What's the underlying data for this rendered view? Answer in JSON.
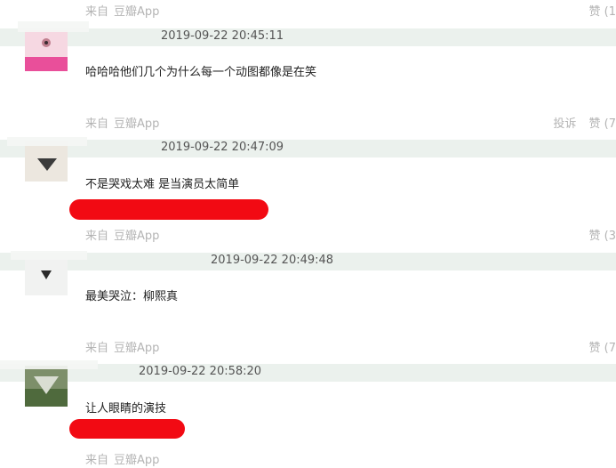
{
  "footer_source": {
    "prefix": "来自",
    "app": "豆瓣App"
  },
  "actions": {
    "report": "投诉",
    "like": "赞"
  },
  "like_counts": [
    "(1",
    "(7",
    "(3",
    "(7"
  ],
  "comments": [
    {
      "timestamp": "2019-09-22 20:45:11",
      "text": "哈哈哈他们几个为什么每一个动图都像是在笑"
    },
    {
      "timestamp": "2019-09-22 20:47:09",
      "text": "不是哭戏太难 是当演员太简单"
    },
    {
      "timestamp": "2019-09-22 20:49:48",
      "text": "最美哭泣：柳熙真"
    },
    {
      "timestamp": "2019-09-22 20:58:20",
      "text": "让人眼睛的演技"
    }
  ],
  "colors": {
    "bar": "#ebf1ed",
    "muted": "#b4b4b4",
    "text": "#222222",
    "redaction": "#f20a13"
  }
}
